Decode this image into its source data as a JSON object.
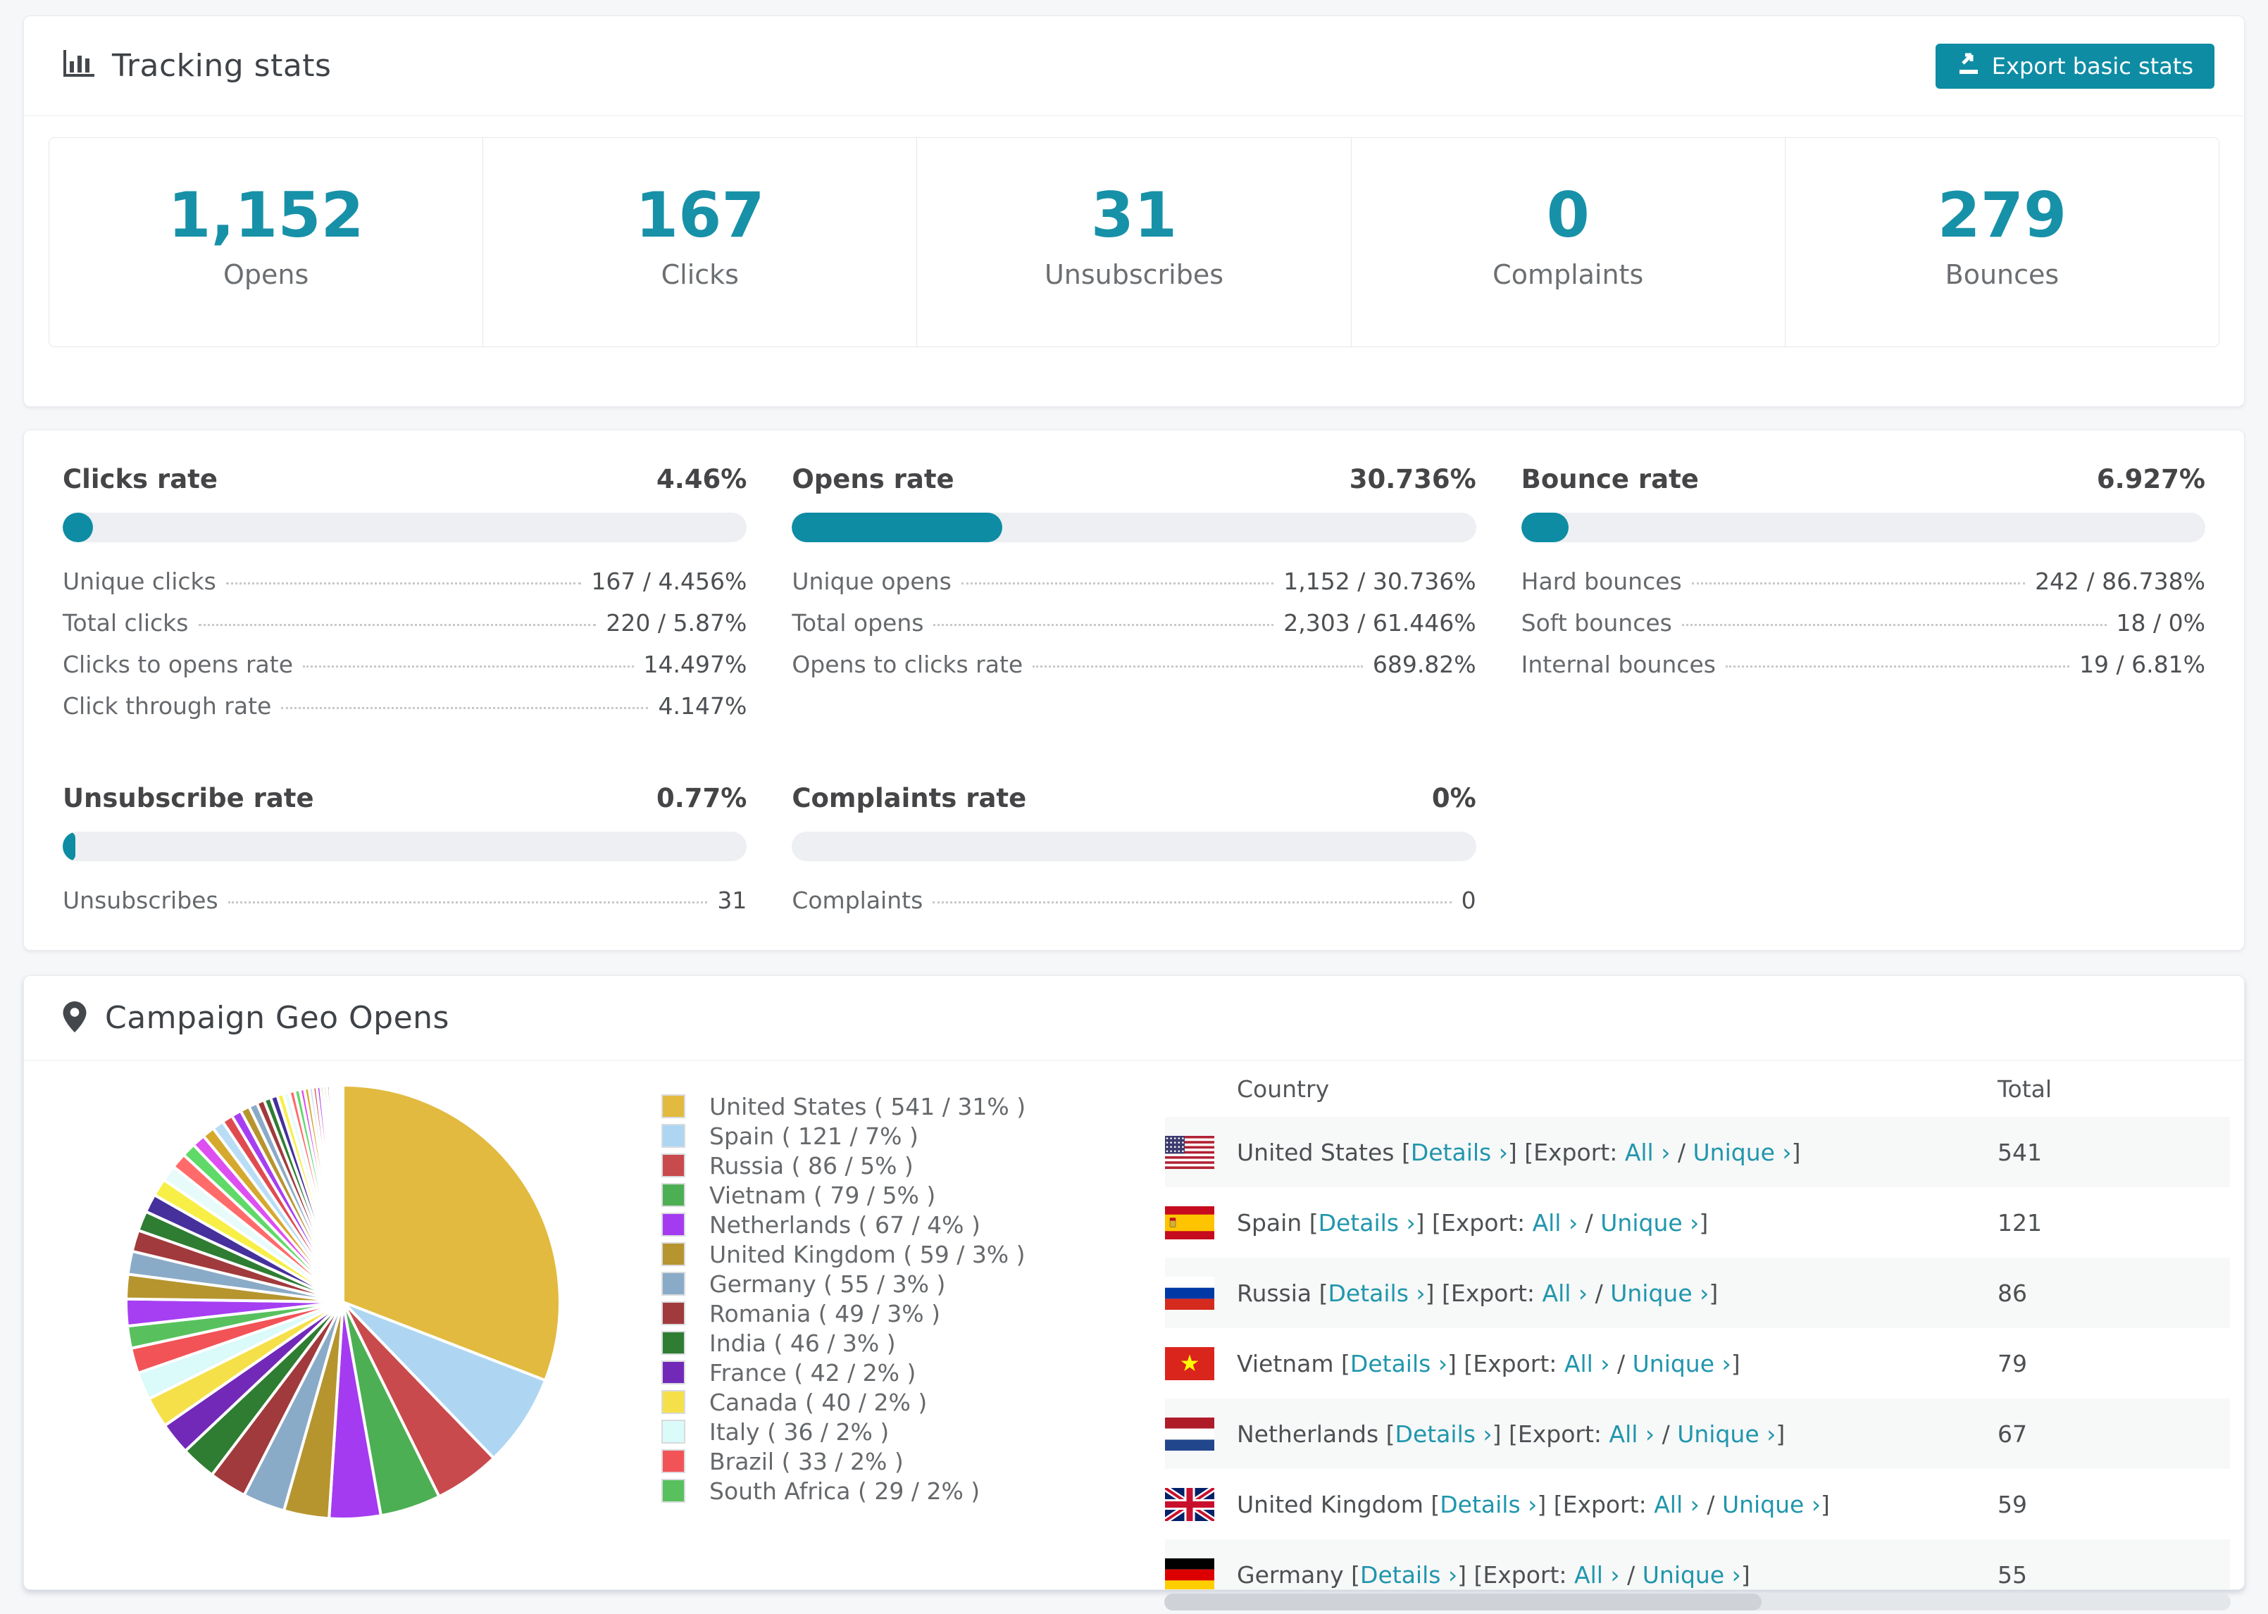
{
  "accent": {
    "teal": "#0e8ca4",
    "link": "#2096ad",
    "number": "#1791a8"
  },
  "tracking": {
    "title": "Tracking stats",
    "export_button": "Export basic stats",
    "stats": [
      {
        "value": "1,152",
        "label": "Opens"
      },
      {
        "value": "167",
        "label": "Clicks"
      },
      {
        "value": "31",
        "label": "Unsubscribes"
      },
      {
        "value": "0",
        "label": "Complaints"
      },
      {
        "value": "279",
        "label": "Bounces"
      }
    ]
  },
  "rates": {
    "blocks": [
      {
        "title": "Clicks rate",
        "value": "4.46%",
        "pct": 4.46,
        "rows": [
          {
            "label": "Unique clicks",
            "value": "167 / 4.456%"
          },
          {
            "label": "Total clicks",
            "value": "220 / 5.87%"
          },
          {
            "label": "Clicks to opens rate",
            "value": "14.497%"
          },
          {
            "label": "Click through rate",
            "value": "4.147%"
          }
        ]
      },
      {
        "title": "Opens rate",
        "value": "30.736%",
        "pct": 30.736,
        "rows": [
          {
            "label": "Unique opens",
            "value": "1,152 / 30.736%"
          },
          {
            "label": "Total opens",
            "value": "2,303 / 61.446%"
          },
          {
            "label": "Opens to clicks rate",
            "value": "689.82%"
          }
        ]
      },
      {
        "title": "Bounce rate",
        "value": "6.927%",
        "pct": 6.927,
        "rows": [
          {
            "label": "Hard bounces",
            "value": "242 / 86.738%"
          },
          {
            "label": "Soft bounces",
            "value": "18 / 0%"
          },
          {
            "label": "Internal bounces",
            "value": "19 / 6.81%"
          }
        ]
      },
      {
        "title": "Unsubscribe rate",
        "value": "0.77%",
        "pct": 0.77,
        "rows": [
          {
            "label": "Unsubscribes",
            "value": "31"
          }
        ]
      },
      {
        "title": "Complaints rate",
        "value": "0%",
        "pct": 0,
        "rows": [
          {
            "label": "Complaints",
            "value": "0"
          }
        ]
      }
    ]
  },
  "geo": {
    "title": "Campaign Geo Opens",
    "table": {
      "headers": [
        "Country",
        "Total"
      ],
      "link_parts": {
        "open": "[",
        "details": "Details ›",
        "close": "]",
        "export_open": "[Export:",
        "all": "All ›",
        "slash": "/",
        "unique": "Unique ›"
      },
      "rows": [
        {
          "country": "United States",
          "flag": "us",
          "flag_icon": "us-flag-icon",
          "total": "541"
        },
        {
          "country": "Spain",
          "flag": "es",
          "flag_icon": "spain-flag-icon",
          "total": "121"
        },
        {
          "country": "Russia",
          "flag": "ru",
          "flag_icon": "russia-flag-icon",
          "total": "86"
        },
        {
          "country": "Vietnam",
          "flag": "vn",
          "flag_icon": "vietnam-flag-icon",
          "total": "79"
        },
        {
          "country": "Netherlands",
          "flag": "nl",
          "flag_icon": "netherlands-flag-icon",
          "total": "67"
        },
        {
          "country": "United Kingdom",
          "flag": "gb",
          "flag_icon": "uk-flag-icon",
          "total": "59"
        },
        {
          "country": "Germany",
          "flag": "de",
          "flag_icon": "germany-flag-icon",
          "total": "55"
        }
      ]
    }
  },
  "chart_data": {
    "type": "pie",
    "title": "Campaign Geo Opens",
    "legend_position": "right",
    "start_angle_deg": -90,
    "direction": "clockwise",
    "slices": [
      {
        "label": "United States",
        "value": 541,
        "pct": 31,
        "color": "#e2ba3f",
        "legend": "United States ( 541 / 31% )"
      },
      {
        "label": "Spain",
        "value": 121,
        "pct": 7,
        "color": "#aed6f2",
        "legend": "Spain ( 121 / 7% )"
      },
      {
        "label": "Russia",
        "value": 86,
        "pct": 5,
        "color": "#c94a4d",
        "legend": "Russia ( 86 / 5% )"
      },
      {
        "label": "Vietnam",
        "value": 79,
        "pct": 5,
        "color": "#4daf53",
        "legend": "Vietnam ( 79 / 5% )"
      },
      {
        "label": "Netherlands",
        "value": 67,
        "pct": 4,
        "color": "#a43bf0",
        "legend": "Netherlands ( 67 / 4% )"
      },
      {
        "label": "United Kingdom",
        "value": 59,
        "pct": 3,
        "color": "#b6952f",
        "legend": "United Kingdom ( 59 / 3% )"
      },
      {
        "label": "Germany",
        "value": 55,
        "pct": 3,
        "color": "#8aabc7",
        "legend": "Germany ( 55 / 3% )"
      },
      {
        "label": "Romania",
        "value": 49,
        "pct": 3,
        "color": "#a13a3c",
        "legend": "Romania ( 49 / 3% )"
      },
      {
        "label": "India",
        "value": 46,
        "pct": 3,
        "color": "#2e7d32",
        "legend": "India ( 46 / 3% )"
      },
      {
        "label": "France",
        "value": 42,
        "pct": 2,
        "color": "#7229b8",
        "legend": "France ( 42 / 2% )"
      },
      {
        "label": "Canada",
        "value": 40,
        "pct": 2,
        "color": "#f6e049",
        "legend": "Canada ( 40 / 2% )"
      },
      {
        "label": "Italy",
        "value": 36,
        "pct": 2,
        "color": "#dbfafa",
        "legend": "Italy ( 36 / 2% )"
      },
      {
        "label": "Brazil",
        "value": 33,
        "pct": 2,
        "color": "#f25357",
        "legend": "Brazil ( 33 / 2% )"
      },
      {
        "label": "South Africa",
        "value": 29,
        "pct": 2,
        "color": "#58c15e",
        "legend": "South Africa ( 29 / 2% )"
      }
    ],
    "unlabeled_slices": [
      [
        35,
        "#a63ff2"
      ],
      [
        32,
        "#b6952f"
      ],
      [
        30,
        "#8aabc7"
      ],
      [
        28,
        "#a13a3c"
      ],
      [
        26,
        "#2e7d32"
      ],
      [
        24,
        "#45309c"
      ],
      [
        23,
        "#f7ef45"
      ],
      [
        21,
        "#e8fbfb"
      ],
      [
        20,
        "#ff6b6b"
      ],
      [
        18,
        "#5fd968"
      ],
      [
        17,
        "#dd4ff0"
      ],
      [
        16,
        "#d4a92e"
      ],
      [
        15,
        "#b9ddf5"
      ],
      [
        14,
        "#e04b50"
      ],
      [
        13,
        "#a63ff2"
      ],
      [
        12,
        "#b6952f"
      ],
      [
        11,
        "#8aabc7"
      ],
      [
        10,
        "#a13a3c"
      ],
      [
        9,
        "#2e7d32"
      ],
      [
        9,
        "#45309c"
      ],
      [
        8,
        "#f7ef45"
      ],
      [
        8,
        "#e8fbfb"
      ],
      [
        7,
        "#ff6b6b"
      ],
      [
        7,
        "#5fd968"
      ],
      [
        6,
        "#dd4ff0"
      ],
      [
        6,
        "#d4a92e"
      ],
      [
        5,
        "#b9ddf5"
      ],
      [
        5,
        "#e04b50"
      ],
      [
        5,
        "#a63ff2"
      ],
      [
        4,
        "#b6952f"
      ],
      [
        4,
        "#8aabc7"
      ],
      [
        4,
        "#a13a3c"
      ],
      [
        3,
        "#2e7d32"
      ],
      [
        3,
        "#45309c"
      ],
      [
        3,
        "#f7ef45"
      ],
      [
        3,
        "#e8fbfb"
      ],
      [
        3,
        "#ff6b6b"
      ],
      [
        2,
        "#5fd968"
      ]
    ]
  }
}
